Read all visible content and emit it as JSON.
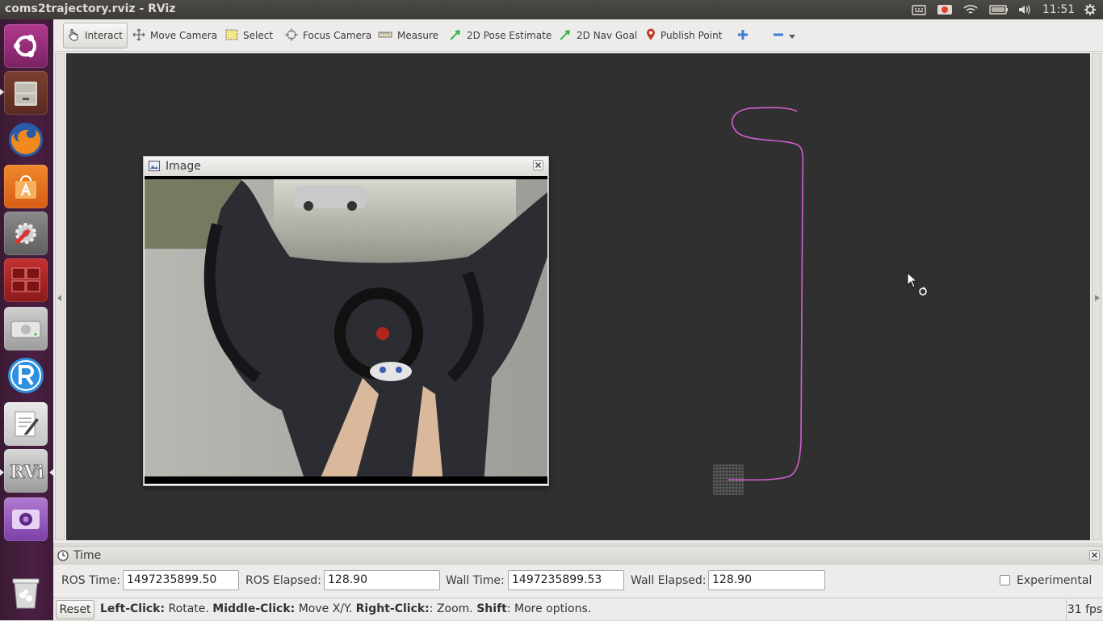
{
  "window": {
    "title": "coms2trajectory.rviz - RViz"
  },
  "system_tray": {
    "clock": "11:51"
  },
  "launcher": {
    "items": [
      {
        "name": "ubuntu-dash",
        "icon": "ubuntu-logo-icon"
      },
      {
        "name": "files",
        "icon": "file-cabinet-icon"
      },
      {
        "name": "firefox",
        "icon": "firefox-icon"
      },
      {
        "name": "software-center",
        "icon": "shopping-bag-icon"
      },
      {
        "name": "system-settings",
        "icon": "gear-wrench-icon"
      },
      {
        "name": "workspace-switcher",
        "icon": "workspace-icon"
      },
      {
        "name": "disk",
        "icon": "hard-disk-icon"
      },
      {
        "name": "rstudio",
        "icon": "r-icon"
      },
      {
        "name": "text-editor",
        "icon": "text-editor-icon"
      },
      {
        "name": "rviz",
        "icon": "rviz-icon"
      },
      {
        "name": "webcam",
        "icon": "webcam-icon"
      },
      {
        "name": "trash",
        "icon": "trash-icon"
      }
    ]
  },
  "toolbar": {
    "tools": [
      {
        "label": "Interact",
        "icon": "hand-pointer-icon",
        "active": true
      },
      {
        "label": "Move Camera",
        "icon": "move-arrows-icon"
      },
      {
        "label": "Select",
        "icon": "select-rectangle-icon"
      },
      {
        "label": "Focus Camera",
        "icon": "focus-crosshair-icon"
      },
      {
        "label": "Measure",
        "icon": "ruler-icon"
      },
      {
        "label": "2D Pose Estimate",
        "icon": "green-arrow-icon"
      },
      {
        "label": "2D Nav Goal",
        "icon": "green-arrow-icon"
      },
      {
        "label": "Publish Point",
        "icon": "map-pin-icon"
      }
    ],
    "add_tool_icon": "plus-icon",
    "remove_tool_icon": "minus-icon"
  },
  "image_panel": {
    "title": "Image"
  },
  "time_panel": {
    "title": "Time",
    "ros_time_label": "ROS Time:",
    "ros_time_value": "1497235899.50",
    "ros_elapsed_label": "ROS Elapsed:",
    "ros_elapsed_value": "128.90",
    "wall_time_label": "Wall Time:",
    "wall_time_value": "1497235899.53",
    "wall_elapsed_label": "Wall Elapsed:",
    "wall_elapsed_value": "128.90",
    "experimental_label": "Experimental",
    "experimental_checked": false
  },
  "statusbar": {
    "reset_label": "Reset",
    "hint_left_click": "Left-Click:",
    "hint_rotate": " Rotate. ",
    "hint_middle_click": "Middle-Click:",
    "hint_move": " Move X/Y. ",
    "hint_right_click": "Right-Click:",
    "hint_zoom": ": Zoom. ",
    "hint_shift": "Shift",
    "hint_more": ": More options.",
    "fps": "31 fps"
  },
  "colors": {
    "trajectory": "#d15fd1",
    "viewport_background": "#303030",
    "launcher_background": "#4b1f42"
  }
}
